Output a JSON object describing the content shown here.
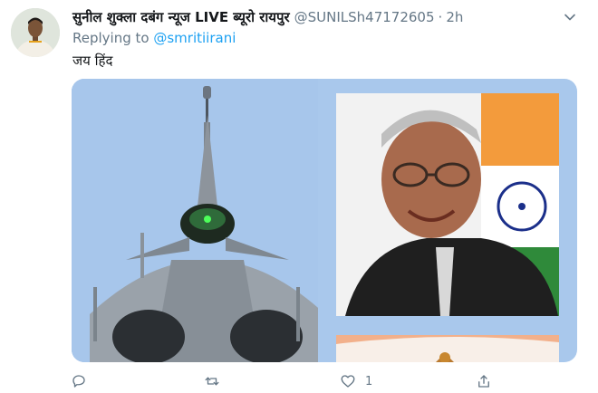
{
  "tweet": {
    "author_name": "सुनील शुक्ला दबंग न्यूज LIVE ब्यूरो रायपुर",
    "author_handle": "@SUNILSh47172605",
    "separator": "·",
    "time": "2h",
    "replying_prefix": "Replying to",
    "replying_to": "@smritiirani",
    "text": "जय हिंद"
  },
  "actions": {
    "reply_count": "",
    "retweet_count": "",
    "like_count": "1",
    "share_count": ""
  },
  "icons": {
    "caret": "chevron-down-icon",
    "reply": "reply-icon",
    "retweet": "retweet-icon",
    "like": "like-icon",
    "share": "share-icon"
  },
  "colors": {
    "link": "#1da1f2",
    "secondary_text": "#657786",
    "primary_text": "#14171a",
    "media_bg": "#a9c8ec"
  }
}
